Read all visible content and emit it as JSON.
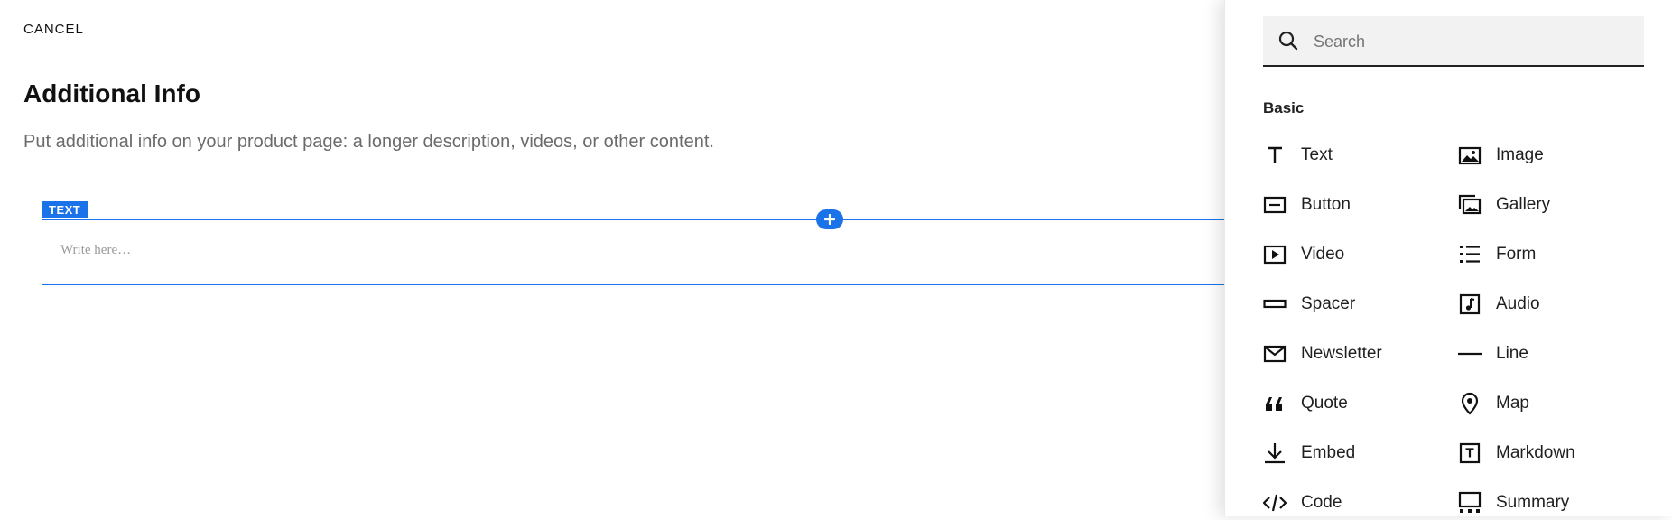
{
  "header": {
    "cancel_label": "CANCEL",
    "title": "Additional Info",
    "subtitle": "Put additional info on your product page: a longer description, videos, or other content."
  },
  "editor": {
    "block_tag": "TEXT",
    "placeholder": "Write here…",
    "add_button_icon": "plus-icon",
    "accent_color": "#1a73e8"
  },
  "panel": {
    "search": {
      "placeholder": "Search",
      "value": "",
      "icon": "search-icon"
    },
    "section_label": "Basic",
    "items": [
      {
        "label": "Text",
        "icon": "text-icon"
      },
      {
        "label": "Image",
        "icon": "image-icon"
      },
      {
        "label": "Button",
        "icon": "button-icon"
      },
      {
        "label": "Gallery",
        "icon": "gallery-icon"
      },
      {
        "label": "Video",
        "icon": "video-icon"
      },
      {
        "label": "Form",
        "icon": "form-icon"
      },
      {
        "label": "Spacer",
        "icon": "spacer-icon"
      },
      {
        "label": "Audio",
        "icon": "audio-icon"
      },
      {
        "label": "Newsletter",
        "icon": "newsletter-icon"
      },
      {
        "label": "Line",
        "icon": "line-icon"
      },
      {
        "label": "Quote",
        "icon": "quote-icon"
      },
      {
        "label": "Map",
        "icon": "map-pin-icon"
      },
      {
        "label": "Embed",
        "icon": "embed-icon"
      },
      {
        "label": "Markdown",
        "icon": "markdown-icon"
      },
      {
        "label": "Code",
        "icon": "code-icon"
      },
      {
        "label": "Summary",
        "icon": "summary-icon"
      }
    ]
  }
}
